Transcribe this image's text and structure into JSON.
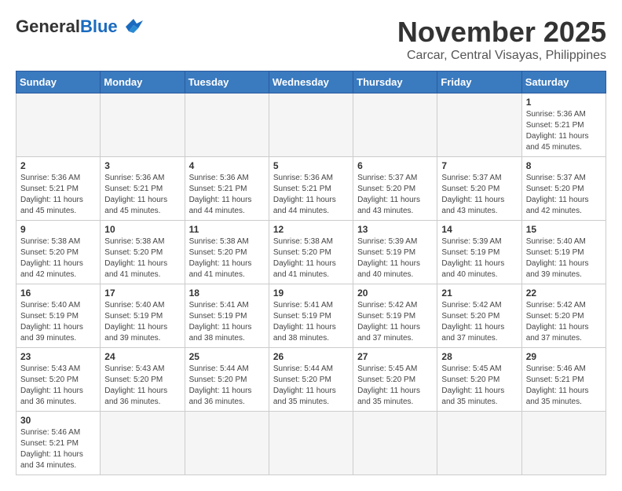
{
  "header": {
    "logo_general": "General",
    "logo_blue": "Blue",
    "month_title": "November 2025",
    "location": "Carcar, Central Visayas, Philippines"
  },
  "days_of_week": [
    "Sunday",
    "Monday",
    "Tuesday",
    "Wednesday",
    "Thursday",
    "Friday",
    "Saturday"
  ],
  "weeks": [
    [
      {
        "day": null
      },
      {
        "day": null
      },
      {
        "day": null
      },
      {
        "day": null
      },
      {
        "day": null
      },
      {
        "day": null
      },
      {
        "day": "1",
        "sunrise": "5:36 AM",
        "sunset": "5:21 PM",
        "daylight": "11 hours and 45 minutes."
      }
    ],
    [
      {
        "day": "2",
        "sunrise": "5:36 AM",
        "sunset": "5:21 PM",
        "daylight": "11 hours and 45 minutes."
      },
      {
        "day": "3",
        "sunrise": "5:36 AM",
        "sunset": "5:21 PM",
        "daylight": "11 hours and 45 minutes."
      },
      {
        "day": "4",
        "sunrise": "5:36 AM",
        "sunset": "5:21 PM",
        "daylight": "11 hours and 44 minutes."
      },
      {
        "day": "5",
        "sunrise": "5:36 AM",
        "sunset": "5:21 PM",
        "daylight": "11 hours and 44 minutes."
      },
      {
        "day": "6",
        "sunrise": "5:37 AM",
        "sunset": "5:20 PM",
        "daylight": "11 hours and 43 minutes."
      },
      {
        "day": "7",
        "sunrise": "5:37 AM",
        "sunset": "5:20 PM",
        "daylight": "11 hours and 43 minutes."
      },
      {
        "day": "8",
        "sunrise": "5:37 AM",
        "sunset": "5:20 PM",
        "daylight": "11 hours and 42 minutes."
      }
    ],
    [
      {
        "day": "9",
        "sunrise": "5:38 AM",
        "sunset": "5:20 PM",
        "daylight": "11 hours and 42 minutes."
      },
      {
        "day": "10",
        "sunrise": "5:38 AM",
        "sunset": "5:20 PM",
        "daylight": "11 hours and 41 minutes."
      },
      {
        "day": "11",
        "sunrise": "5:38 AM",
        "sunset": "5:20 PM",
        "daylight": "11 hours and 41 minutes."
      },
      {
        "day": "12",
        "sunrise": "5:38 AM",
        "sunset": "5:20 PM",
        "daylight": "11 hours and 41 minutes."
      },
      {
        "day": "13",
        "sunrise": "5:39 AM",
        "sunset": "5:19 PM",
        "daylight": "11 hours and 40 minutes."
      },
      {
        "day": "14",
        "sunrise": "5:39 AM",
        "sunset": "5:19 PM",
        "daylight": "11 hours and 40 minutes."
      },
      {
        "day": "15",
        "sunrise": "5:40 AM",
        "sunset": "5:19 PM",
        "daylight": "11 hours and 39 minutes."
      }
    ],
    [
      {
        "day": "16",
        "sunrise": "5:40 AM",
        "sunset": "5:19 PM",
        "daylight": "11 hours and 39 minutes."
      },
      {
        "day": "17",
        "sunrise": "5:40 AM",
        "sunset": "5:19 PM",
        "daylight": "11 hours and 39 minutes."
      },
      {
        "day": "18",
        "sunrise": "5:41 AM",
        "sunset": "5:19 PM",
        "daylight": "11 hours and 38 minutes."
      },
      {
        "day": "19",
        "sunrise": "5:41 AM",
        "sunset": "5:19 PM",
        "daylight": "11 hours and 38 minutes."
      },
      {
        "day": "20",
        "sunrise": "5:42 AM",
        "sunset": "5:19 PM",
        "daylight": "11 hours and 37 minutes."
      },
      {
        "day": "21",
        "sunrise": "5:42 AM",
        "sunset": "5:20 PM",
        "daylight": "11 hours and 37 minutes."
      },
      {
        "day": "22",
        "sunrise": "5:42 AM",
        "sunset": "5:20 PM",
        "daylight": "11 hours and 37 minutes."
      }
    ],
    [
      {
        "day": "23",
        "sunrise": "5:43 AM",
        "sunset": "5:20 PM",
        "daylight": "11 hours and 36 minutes."
      },
      {
        "day": "24",
        "sunrise": "5:43 AM",
        "sunset": "5:20 PM",
        "daylight": "11 hours and 36 minutes."
      },
      {
        "day": "25",
        "sunrise": "5:44 AM",
        "sunset": "5:20 PM",
        "daylight": "11 hours and 36 minutes."
      },
      {
        "day": "26",
        "sunrise": "5:44 AM",
        "sunset": "5:20 PM",
        "daylight": "11 hours and 35 minutes."
      },
      {
        "day": "27",
        "sunrise": "5:45 AM",
        "sunset": "5:20 PM",
        "daylight": "11 hours and 35 minutes."
      },
      {
        "day": "28",
        "sunrise": "5:45 AM",
        "sunset": "5:20 PM",
        "daylight": "11 hours and 35 minutes."
      },
      {
        "day": "29",
        "sunrise": "5:46 AM",
        "sunset": "5:21 PM",
        "daylight": "11 hours and 35 minutes."
      }
    ],
    [
      {
        "day": "30",
        "sunrise": "5:46 AM",
        "sunset": "5:21 PM",
        "daylight": "11 hours and 34 minutes."
      },
      {
        "day": null
      },
      {
        "day": null
      },
      {
        "day": null
      },
      {
        "day": null
      },
      {
        "day": null
      },
      {
        "day": null
      }
    ]
  ]
}
